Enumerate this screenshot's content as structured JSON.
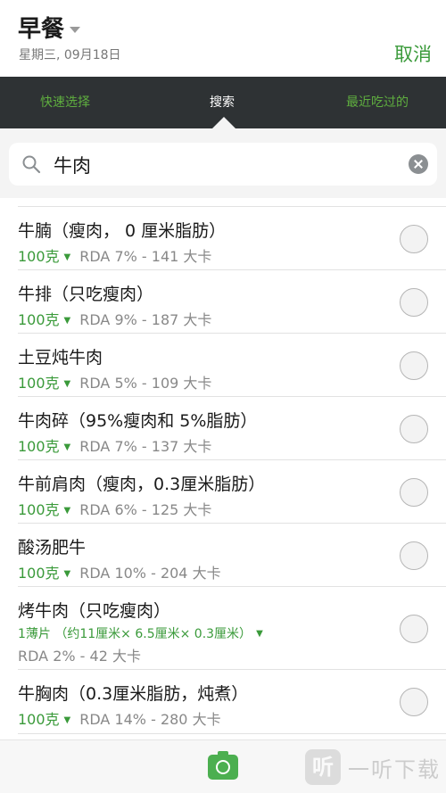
{
  "header": {
    "title": "早餐",
    "date": "星期三, 09月18日",
    "cancel_label": "取消"
  },
  "tabs": [
    {
      "label": "快速选择",
      "active": false
    },
    {
      "label": "搜索",
      "active": true
    },
    {
      "label": "最近吃过的",
      "active": false
    }
  ],
  "search": {
    "value": "牛肉"
  },
  "results": [
    {
      "name": "牛腩（瘦肉， 0 厘米脂肪）",
      "portion": "100克",
      "info": "RDA 7% - 141 大卡"
    },
    {
      "name": "牛排（只吃瘦肉）",
      "portion": "100克",
      "info": "RDA 9% - 187 大卡"
    },
    {
      "name": "土豆炖牛肉",
      "portion": "100克",
      "info": "RDA 5% - 109 大卡"
    },
    {
      "name": "牛肉碎（95%瘦肉和 5%脂肪）",
      "portion": "100克",
      "info": "RDA 7% - 137 大卡"
    },
    {
      "name": "牛前肩肉（瘦肉，0.3厘米脂肪）",
      "portion": "100克",
      "info": "RDA 6% - 125 大卡"
    },
    {
      "name": "酸汤肥牛",
      "portion": "100克",
      "info": "RDA 10% - 204 大卡"
    },
    {
      "name": "烤牛肉（只吃瘦肉）",
      "portion": "1薄片 （约11厘米× 6.5厘米× 0.3厘米）",
      "info": "RDA 2% - 42 大卡"
    },
    {
      "name": "牛胸肉（0.3厘米脂肪，炖煮）",
      "portion": "100克",
      "info": "RDA 14% - 280 大卡"
    }
  ],
  "watermark": {
    "logo_text": "听",
    "text": "一听下载"
  },
  "colors": {
    "accent": "#3a9a3a",
    "tabbar_bg": "#2e3234",
    "tab_inactive": "#5fae3f"
  },
  "icons": {
    "search": "search-icon",
    "clear": "clear-icon",
    "camera": "camera-icon"
  }
}
